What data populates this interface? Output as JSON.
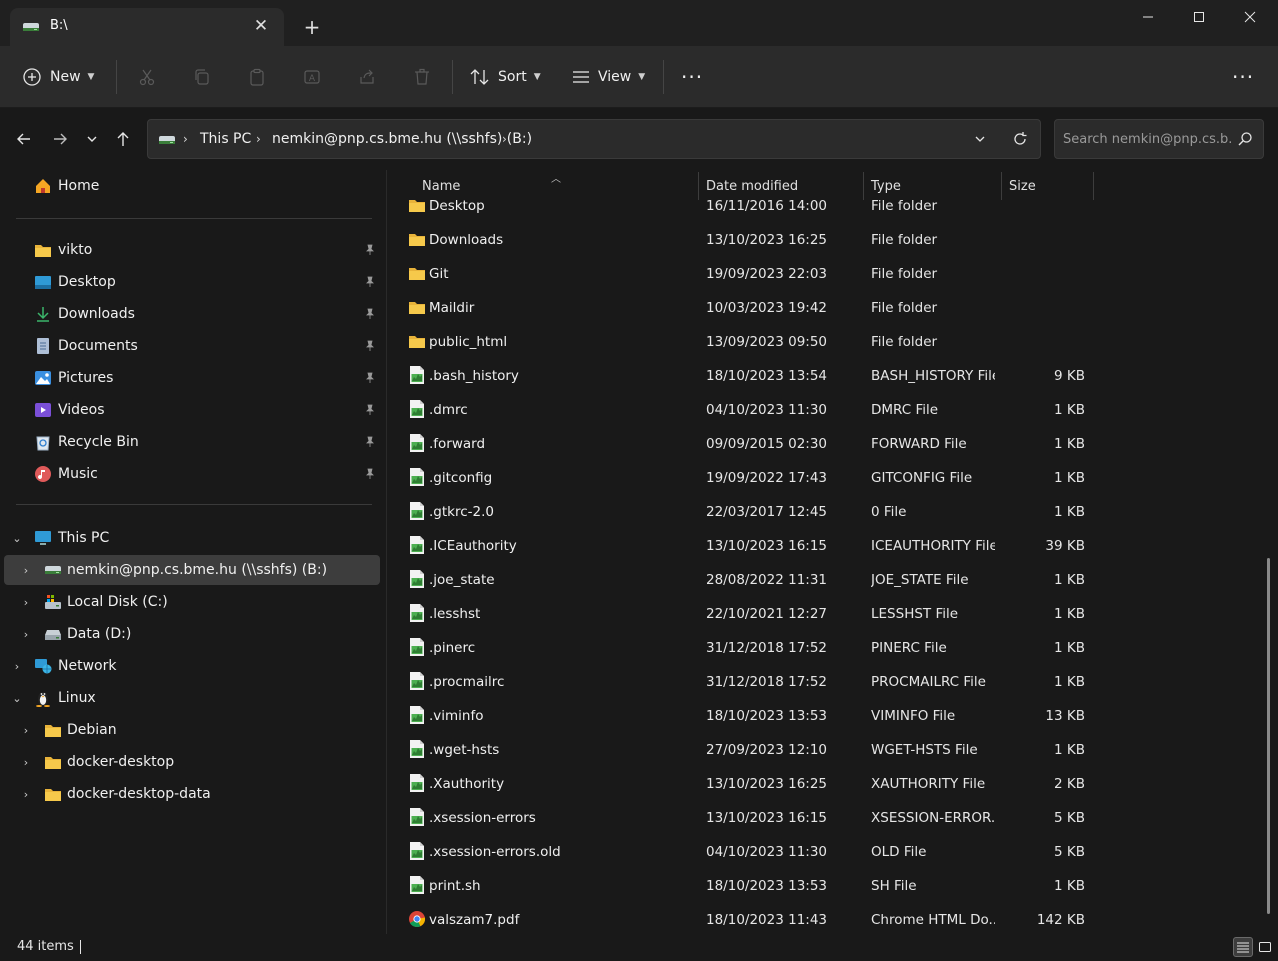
{
  "window": {
    "tab_title": "B:\\",
    "tab_close": "✕",
    "new_tab": "+"
  },
  "toolbar": {
    "new_label": "New",
    "sort_label": "Sort",
    "view_label": "View",
    "more": "···"
  },
  "address": {
    "crumbs": [
      "This PC",
      "nemkin@pnp.cs.bme.hu (\\\\sshfs) (B:)"
    ],
    "search_placeholder": "Search nemkin@pnp.cs.b..."
  },
  "sidebar": {
    "quick": [
      {
        "label": "Home",
        "icon": "home-icon"
      },
      {
        "label": "vikto",
        "icon": "folder-icon",
        "pinned": true
      },
      {
        "label": "Desktop",
        "icon": "desktop-icon",
        "pinned": true
      },
      {
        "label": "Downloads",
        "icon": "download-icon",
        "pinned": true
      },
      {
        "label": "Documents",
        "icon": "documents-icon",
        "pinned": true
      },
      {
        "label": "Pictures",
        "icon": "pictures-icon",
        "pinned": true
      },
      {
        "label": "Videos",
        "icon": "videos-icon",
        "pinned": true
      },
      {
        "label": "Recycle Bin",
        "icon": "recycle-bin-icon",
        "pinned": true
      },
      {
        "label": "Music",
        "icon": "music-icon",
        "pinned": true
      }
    ],
    "tree": [
      {
        "label": "This PC",
        "icon": "this-pc-icon",
        "expanded": true
      },
      {
        "label": "nemkin@pnp.cs.bme.hu (\\\\sshfs) (B:)",
        "icon": "network-drive-icon",
        "selected": true
      },
      {
        "label": "Local Disk (C:)",
        "icon": "local-disk-icon"
      },
      {
        "label": "Data (D:)",
        "icon": "drive-icon"
      },
      {
        "label": "Network",
        "icon": "network-icon"
      },
      {
        "label": "Linux",
        "icon": "linux-icon",
        "expanded": true
      },
      {
        "label": "Debian",
        "icon": "folder-icon"
      },
      {
        "label": "docker-desktop",
        "icon": "folder-icon"
      },
      {
        "label": "docker-desktop-data",
        "icon": "folder-icon"
      }
    ]
  },
  "columns": {
    "name": "Name",
    "date": "Date modified",
    "type": "Type",
    "size": "Size"
  },
  "files": [
    {
      "name": "Desktop",
      "date": "16/11/2016 14:00",
      "type": "File folder",
      "size": "",
      "icon": "folder-icon"
    },
    {
      "name": "Downloads",
      "date": "13/10/2023 16:25",
      "type": "File folder",
      "size": "",
      "icon": "folder-icon"
    },
    {
      "name": "Git",
      "date": "19/09/2023 22:03",
      "type": "File folder",
      "size": "",
      "icon": "folder-icon"
    },
    {
      "name": "Maildir",
      "date": "10/03/2023 19:42",
      "type": "File folder",
      "size": "",
      "icon": "folder-icon"
    },
    {
      "name": "public_html",
      "date": "13/09/2023 09:50",
      "type": "File folder",
      "size": "",
      "icon": "folder-icon"
    },
    {
      "name": ".bash_history",
      "date": "18/10/2023 13:54",
      "type": "BASH_HISTORY File",
      "size": "9 KB",
      "icon": "file-icon"
    },
    {
      "name": ".dmrc",
      "date": "04/10/2023 11:30",
      "type": "DMRC File",
      "size": "1 KB",
      "icon": "file-icon"
    },
    {
      "name": ".forward",
      "date": "09/09/2015 02:30",
      "type": "FORWARD File",
      "size": "1 KB",
      "icon": "file-icon"
    },
    {
      "name": ".gitconfig",
      "date": "19/09/2022 17:43",
      "type": "GITCONFIG File",
      "size": "1 KB",
      "icon": "file-icon"
    },
    {
      "name": ".gtkrc-2.0",
      "date": "22/03/2017 12:45",
      "type": "0 File",
      "size": "1 KB",
      "icon": "file-icon"
    },
    {
      "name": ".ICEauthority",
      "date": "13/10/2023 16:15",
      "type": "ICEAUTHORITY File",
      "size": "39 KB",
      "icon": "file-icon"
    },
    {
      "name": ".joe_state",
      "date": "28/08/2022 11:31",
      "type": "JOE_STATE File",
      "size": "1 KB",
      "icon": "file-icon"
    },
    {
      "name": ".lesshst",
      "date": "22/10/2021 12:27",
      "type": "LESSHST File",
      "size": "1 KB",
      "icon": "file-icon"
    },
    {
      "name": ".pinerc",
      "date": "31/12/2018 17:52",
      "type": "PINERC File",
      "size": "1 KB",
      "icon": "file-icon"
    },
    {
      "name": ".procmailrc",
      "date": "31/12/2018 17:52",
      "type": "PROCMAILRC File",
      "size": "1 KB",
      "icon": "file-icon"
    },
    {
      "name": ".viminfo",
      "date": "18/10/2023 13:53",
      "type": "VIMINFO File",
      "size": "13 KB",
      "icon": "file-icon"
    },
    {
      "name": ".wget-hsts",
      "date": "27/09/2023 12:10",
      "type": "WGET-HSTS File",
      "size": "1 KB",
      "icon": "file-icon"
    },
    {
      "name": ".Xauthority",
      "date": "13/10/2023 16:25",
      "type": "XAUTHORITY File",
      "size": "2 KB",
      "icon": "file-icon"
    },
    {
      "name": ".xsession-errors",
      "date": "13/10/2023 16:15",
      "type": "XSESSION-ERROR...",
      "size": "5 KB",
      "icon": "file-icon"
    },
    {
      "name": ".xsession-errors.old",
      "date": "04/10/2023 11:30",
      "type": "OLD File",
      "size": "5 KB",
      "icon": "file-icon"
    },
    {
      "name": "print.sh",
      "date": "18/10/2023 13:53",
      "type": "SH File",
      "size": "1 KB",
      "icon": "file-icon"
    },
    {
      "name": "valszam7.pdf",
      "date": "18/10/2023 11:43",
      "type": "Chrome HTML Do...",
      "size": "142 KB",
      "icon": "chrome-icon"
    }
  ],
  "status": {
    "item_count": "44 items"
  }
}
